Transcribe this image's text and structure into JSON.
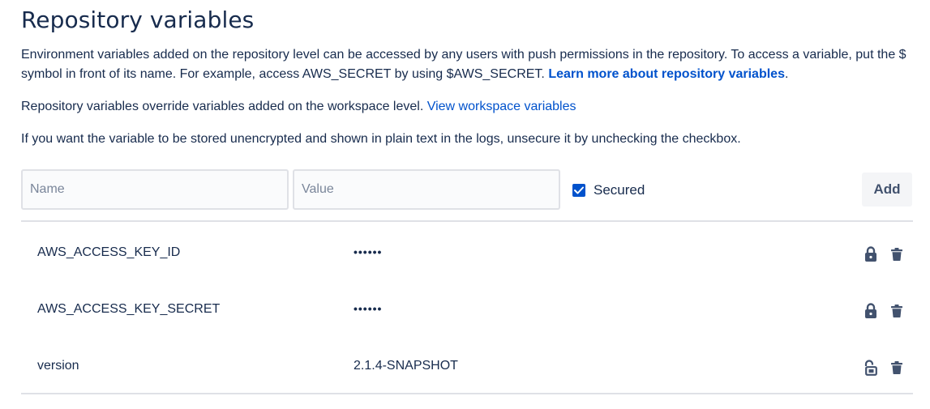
{
  "title": "Repository variables",
  "intro": {
    "text": "Environment variables added on the repository level can be accessed by any users with push permissions in the repository. To access a variable, put the $ symbol in front of its name. For example, access AWS_SECRET by using $AWS_SECRET. ",
    "link": "Learn more about repository variables",
    "after_link": "."
  },
  "override": {
    "text": "Repository variables override variables added on the workspace level. ",
    "link": "View workspace variables"
  },
  "unsecure_note": "If you want the variable to be stored unencrypted and shown in plain text in the logs, unsecure it by unchecking the checkbox.",
  "form": {
    "name_placeholder": "Name",
    "value_placeholder": "Value",
    "secured_label": "Secured",
    "secured_checked": true,
    "add_label": "Add"
  },
  "variables": [
    {
      "name": "AWS_ACCESS_KEY_ID",
      "value": "••••••",
      "secured": true,
      "lock_icon": "lock-icon",
      "delete_icon": "trash-icon"
    },
    {
      "name": "AWS_ACCESS_KEY_SECRET",
      "value": "••••••",
      "secured": true,
      "lock_icon": "lock-icon",
      "delete_icon": "trash-icon"
    },
    {
      "name": "version",
      "value": "2.1.4-SNAPSHOT",
      "secured": false,
      "lock_icon": "unlock-icon",
      "delete_icon": "trash-icon"
    }
  ],
  "colors": {
    "link": "#0052cc",
    "text": "#172b4d",
    "icon": "#42526e",
    "checkbox": "#0052cc"
  }
}
